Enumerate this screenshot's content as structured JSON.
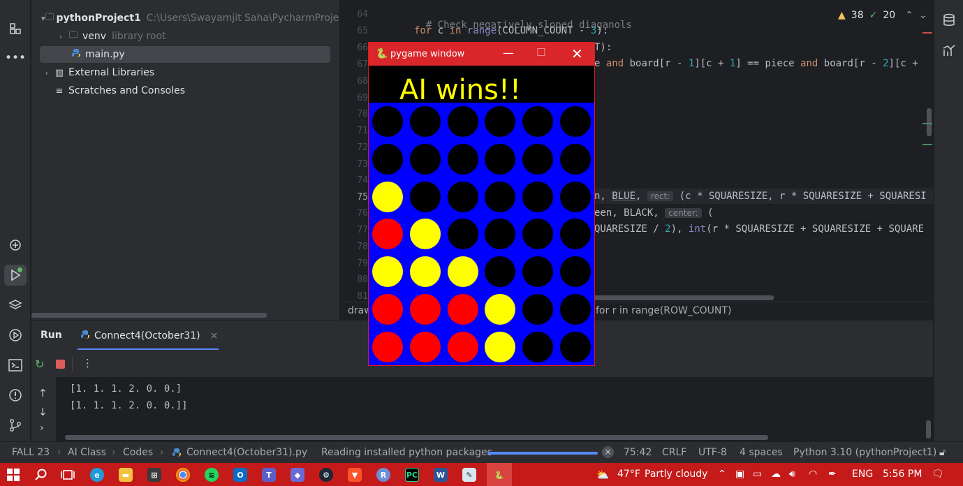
{
  "project": {
    "root_name": "pythonProject1",
    "root_path": "C:\\Users\\Swayamjit Saha\\PycharmProjec",
    "items": [
      {
        "label": "venv",
        "note": "library root"
      },
      {
        "label": "main.py"
      },
      {
        "label": "External Libraries"
      },
      {
        "label": "Scratches and Consoles"
      }
    ]
  },
  "editor": {
    "line_numbers": [
      "64",
      "65",
      "66",
      "67",
      "68",
      "69",
      "70",
      "71",
      "72",
      "73",
      "74",
      "75",
      "76",
      "77",
      "78",
      "79",
      "80",
      "81"
    ],
    "current_line": "75",
    "line64": "# Check negatively sloped diaganols",
    "line65_kw1": "for",
    "line65_var": " c ",
    "line65_kw2": "in",
    "line65_fn": " range",
    "line65_rest": "(COLUMN_COUNT - ",
    "line65_num": "3",
    "line65_end": "):",
    "line66_frag": "T):",
    "line67_frag_a": "e ",
    "line67_kw": "and",
    "line67_frag_b": " board[r - ",
    "line67_num1": "1",
    "line67_frag_c": "][c + ",
    "line67_num2": "1",
    "line67_frag_d": "] == piece ",
    "line67_kw2": "and",
    "line67_frag_e": " board[r - ",
    "line67_num3": "2",
    "line67_frag_f": "][c + ",
    "line75_frag": "n, ",
    "line75_blue": "BLUE",
    "line75_comma": ", ",
    "line75_hint": "rect:",
    "line75_rest": " (c * SQUARESIZE, r * SQUARESIZE + SQUARESI",
    "line76_frag": "een, BLACK, ",
    "line76_hint": "center:",
    "line76_rest": " (",
    "line77_frag": "QUARESIZE / ",
    "line77_num": "2",
    "line77_mid": "), ",
    "line77_int": "int",
    "line77_rest": "(r * SQUARESIZE + SQUARESIZE + SQUARE",
    "breadcrumb_left": "draw",
    "breadcrumb_right": "for r in range(ROW_COUNT)",
    "warnings": "38",
    "ok": "20"
  },
  "run": {
    "tab_title": "Run",
    "config_name": "Connect4(October31)",
    "output_lines": [
      "[1. 1. 1. 2. 0. 0.]",
      "[1. 1. 1. 2. 0. 0.]]"
    ]
  },
  "status": {
    "crumbs": [
      "FALL 23",
      "AI Class",
      "Codes",
      "Connect4(October31).py"
    ],
    "task": "Reading installed python packages",
    "progress": 1.0,
    "position": "75:42",
    "line_sep": "CRLF",
    "encoding": "UTF-8",
    "indent": "4 spaces",
    "interpreter": "Python 3.10 (pythonProject1)"
  },
  "pygame": {
    "title": "pygame window",
    "message": "AI wins!!",
    "colors": {
      "board": "#0000fe",
      "empty": "#000000",
      "player": "#fe0000",
      "ai": "#ffff00"
    },
    "board": [
      [
        "E",
        "E",
        "E",
        "E",
        "E",
        "E"
      ],
      [
        "E",
        "E",
        "E",
        "E",
        "E",
        "E"
      ],
      [
        "Y",
        "E",
        "E",
        "E",
        "E",
        "E"
      ],
      [
        "R",
        "Y",
        "E",
        "E",
        "E",
        "E"
      ],
      [
        "Y",
        "Y",
        "Y",
        "E",
        "E",
        "E"
      ],
      [
        "R",
        "R",
        "R",
        "Y",
        "E",
        "E"
      ],
      [
        "R",
        "R",
        "R",
        "Y",
        "E",
        "E"
      ]
    ]
  },
  "taskbar": {
    "weather_temp": "47°F",
    "weather_desc": "Partly cloudy",
    "language": "ENG",
    "time": "5:56 PM"
  }
}
